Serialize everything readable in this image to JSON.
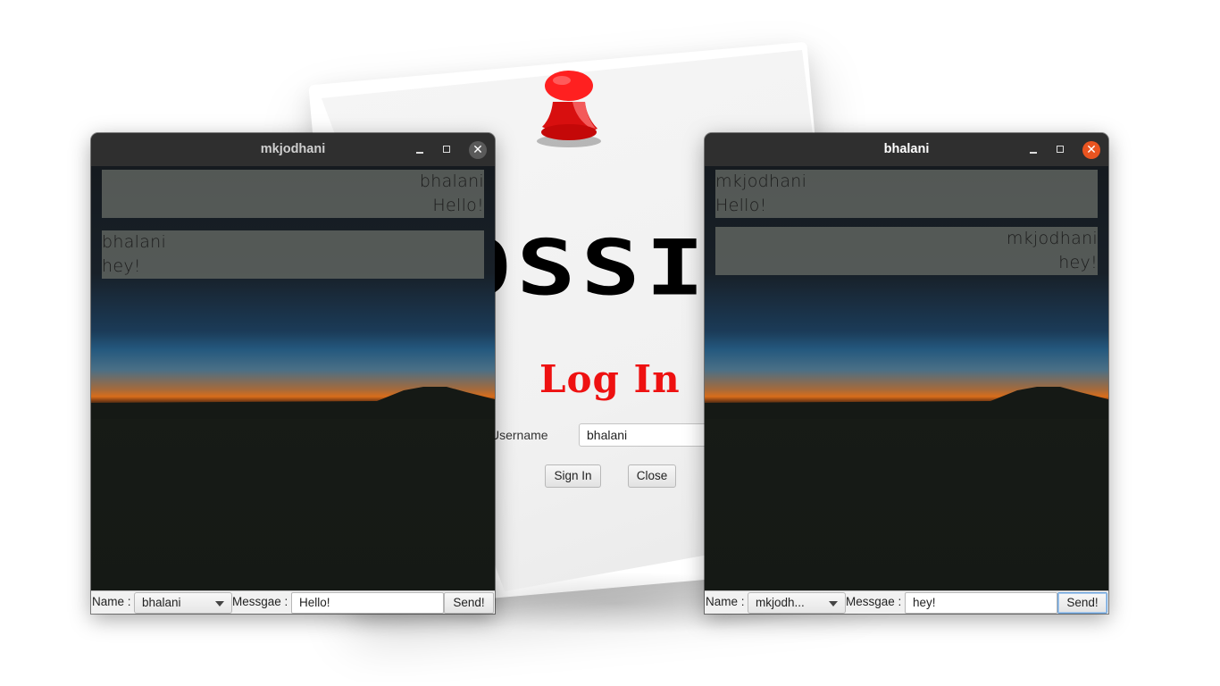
{
  "login": {
    "logo_text": "OSSI",
    "title": "Log In",
    "username_label": "Username",
    "username_value": "bhalani",
    "signin_label": "Sign In",
    "close_label": "Close",
    "title_color": "#ee1111"
  },
  "left_window": {
    "title": "mkjodhani",
    "messages": [
      {
        "align": "right",
        "sender": "bhalani",
        "text": "Hello!"
      },
      {
        "align": "left",
        "sender": "bhalani",
        "text": "hey!"
      }
    ],
    "name_label": "Name :",
    "name_value": "bhalani",
    "message_label": "Messgae :",
    "message_value": "Hello!",
    "send_label": "Send!"
  },
  "right_window": {
    "title": "bhalani",
    "messages": [
      {
        "align": "left",
        "sender": "mkjodhani",
        "text": "Hello!"
      },
      {
        "align": "right",
        "sender": "mkjodhani",
        "text": "hey!"
      }
    ],
    "name_label": "Name :",
    "name_value": "mkjodh...",
    "message_label": "Messgae :",
    "message_value": "hey!",
    "send_label": "Send!"
  },
  "colors": {
    "titlebar": "#2f2f2f",
    "close_active": "#e95420",
    "close_inactive": "#5a5a5a"
  }
}
